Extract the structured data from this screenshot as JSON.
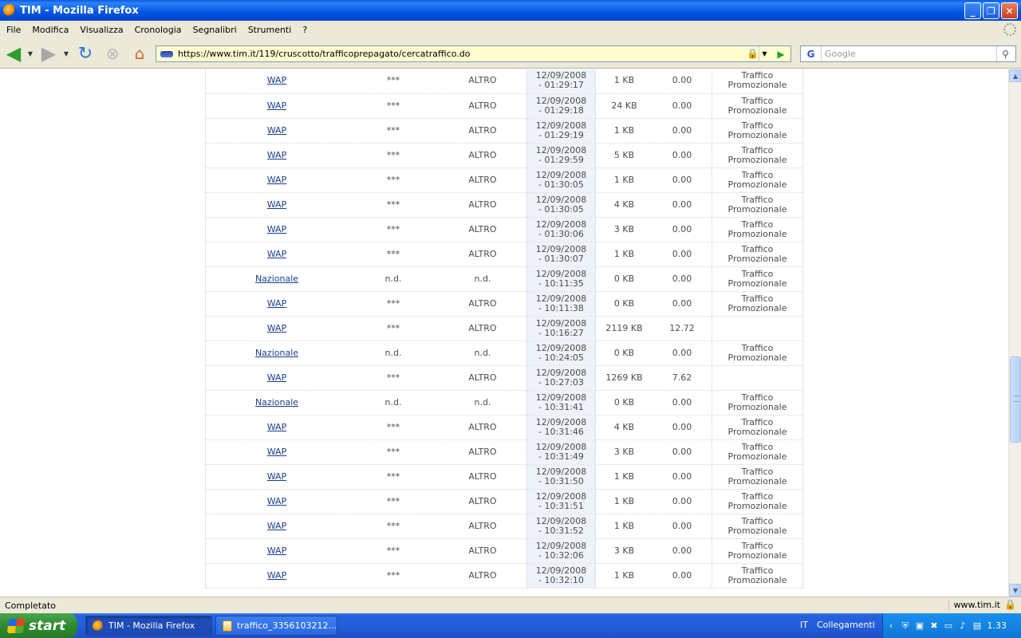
{
  "window": {
    "title": "TIM - Mozilla Firefox"
  },
  "menu": [
    "File",
    "Modifica",
    "Visualizza",
    "Cronologia",
    "Segnalibri",
    "Strumenti",
    "?"
  ],
  "nav": {
    "url": "https://www.tim.it/119/cruscotto/trafficoprepagato/cercatraffico.do",
    "search_placeholder": "Google"
  },
  "table": {
    "rows": [
      {
        "service": "WAP",
        "number": "***",
        "type": "ALTRO",
        "date": "12/09/2008",
        "time": "- 01:29:17",
        "size": "1 KB",
        "cost": "0.00",
        "note1": "Traffico",
        "note2": "Promozionale"
      },
      {
        "service": "WAP",
        "number": "***",
        "type": "ALTRO",
        "date": "12/09/2008",
        "time": "- 01:29:18",
        "size": "24 KB",
        "cost": "0.00",
        "note1": "Traffico",
        "note2": "Promozionale"
      },
      {
        "service": "WAP",
        "number": "***",
        "type": "ALTRO",
        "date": "12/09/2008",
        "time": "- 01:29:19",
        "size": "1 KB",
        "cost": "0.00",
        "note1": "Traffico",
        "note2": "Promozionale"
      },
      {
        "service": "WAP",
        "number": "***",
        "type": "ALTRO",
        "date": "12/09/2008",
        "time": "- 01:29:59",
        "size": "5 KB",
        "cost": "0.00",
        "note1": "Traffico",
        "note2": "Promozionale"
      },
      {
        "service": "WAP",
        "number": "***",
        "type": "ALTRO",
        "date": "12/09/2008",
        "time": "- 01:30:05",
        "size": "1 KB",
        "cost": "0.00",
        "note1": "Traffico",
        "note2": "Promozionale"
      },
      {
        "service": "WAP",
        "number": "***",
        "type": "ALTRO",
        "date": "12/09/2008",
        "time": "- 01:30:05",
        "size": "4 KB",
        "cost": "0.00",
        "note1": "Traffico",
        "note2": "Promozionale"
      },
      {
        "service": "WAP",
        "number": "***",
        "type": "ALTRO",
        "date": "12/09/2008",
        "time": "- 01:30:06",
        "size": "3 KB",
        "cost": "0.00",
        "note1": "Traffico",
        "note2": "Promozionale"
      },
      {
        "service": "WAP",
        "number": "***",
        "type": "ALTRO",
        "date": "12/09/2008",
        "time": "- 01:30:07",
        "size": "1 KB",
        "cost": "0.00",
        "note1": "Traffico",
        "note2": "Promozionale"
      },
      {
        "service": "Nazionale",
        "number": "n.d.",
        "type": "n.d.",
        "date": "12/09/2008",
        "time": "- 10:11:35",
        "size": "0 KB",
        "cost": "0.00",
        "note1": "Traffico",
        "note2": "Promozionale"
      },
      {
        "service": "WAP",
        "number": "***",
        "type": "ALTRO",
        "date": "12/09/2008",
        "time": "- 10:11:38",
        "size": "0 KB",
        "cost": "0.00",
        "note1": "Traffico",
        "note2": "Promozionale"
      },
      {
        "service": "WAP",
        "number": "***",
        "type": "ALTRO",
        "date": "12/09/2008",
        "time": "- 10:16:27",
        "size": "2119 KB",
        "cost": "12.72",
        "note1": "",
        "note2": ""
      },
      {
        "service": "Nazionale",
        "number": "n.d.",
        "type": "n.d.",
        "date": "12/09/2008",
        "time": "- 10:24:05",
        "size": "0 KB",
        "cost": "0.00",
        "note1": "Traffico",
        "note2": "Promozionale"
      },
      {
        "service": "WAP",
        "number": "***",
        "type": "ALTRO",
        "date": "12/09/2008",
        "time": "- 10:27:03",
        "size": "1269 KB",
        "cost": "7.62",
        "note1": "",
        "note2": ""
      },
      {
        "service": "Nazionale",
        "number": "n.d.",
        "type": "n.d.",
        "date": "12/09/2008",
        "time": "- 10:31:41",
        "size": "0 KB",
        "cost": "0.00",
        "note1": "Traffico",
        "note2": "Promozionale"
      },
      {
        "service": "WAP",
        "number": "***",
        "type": "ALTRO",
        "date": "12/09/2008",
        "time": "- 10:31:46",
        "size": "4 KB",
        "cost": "0.00",
        "note1": "Traffico",
        "note2": "Promozionale"
      },
      {
        "service": "WAP",
        "number": "***",
        "type": "ALTRO",
        "date": "12/09/2008",
        "time": "- 10:31:49",
        "size": "3 KB",
        "cost": "0.00",
        "note1": "Traffico",
        "note2": "Promozionale"
      },
      {
        "service": "WAP",
        "number": "***",
        "type": "ALTRO",
        "date": "12/09/2008",
        "time": "- 10:31:50",
        "size": "1 KB",
        "cost": "0.00",
        "note1": "Traffico",
        "note2": "Promozionale"
      },
      {
        "service": "WAP",
        "number": "***",
        "type": "ALTRO",
        "date": "12/09/2008",
        "time": "- 10:31:51",
        "size": "1 KB",
        "cost": "0.00",
        "note1": "Traffico",
        "note2": "Promozionale"
      },
      {
        "service": "WAP",
        "number": "***",
        "type": "ALTRO",
        "date": "12/09/2008",
        "time": "- 10:31:52",
        "size": "1 KB",
        "cost": "0.00",
        "note1": "Traffico",
        "note2": "Promozionale"
      },
      {
        "service": "WAP",
        "number": "***",
        "type": "ALTRO",
        "date": "12/09/2008",
        "time": "- 10:32:06",
        "size": "3 KB",
        "cost": "0.00",
        "note1": "Traffico",
        "note2": "Promozionale"
      },
      {
        "service": "WAP",
        "number": "***",
        "type": "ALTRO",
        "date": "12/09/2008",
        "time": "- 10:32:10",
        "size": "1 KB",
        "cost": "0.00",
        "note1": "Traffico",
        "note2": "Promozionale"
      }
    ]
  },
  "status": {
    "text": "Completato",
    "host": "www.tim.it"
  },
  "taskbar": {
    "start_label": "start",
    "tasks": [
      {
        "label": "TIM - Mozilla Firefox"
      },
      {
        "label": "traffico_3356103212..."
      }
    ],
    "lang": "IT",
    "links_label": "Collegamenti",
    "clock": "1.33"
  },
  "icons": {
    "back": "arrow-left",
    "forward": "arrow-right",
    "reload": "reload",
    "stop": "stop",
    "home": "home",
    "go": "play",
    "search": "magnifier",
    "lock": "padlock"
  },
  "colors": {
    "link": "#1b3d8f",
    "title_bar": "#0054e3",
    "url_bg": "#fffdd0",
    "date_col_bg": "#eef3f9"
  }
}
